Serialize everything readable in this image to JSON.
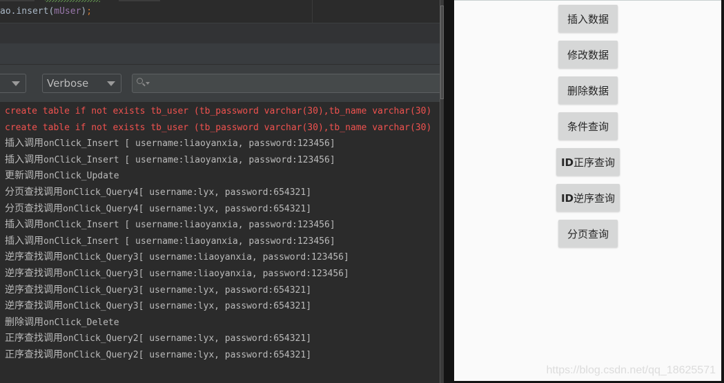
{
  "editor": {
    "code_prefix": "ao.",
    "code_method": "insert(",
    "code_arg": "mUser",
    "code_close": ")",
    "code_semi": ";"
  },
  "logcat": {
    "device_dropdown": {
      "value": ""
    },
    "level_dropdown": {
      "value": "Verbose"
    },
    "search": {
      "value": "",
      "placeholder": ""
    },
    "lines": [
      {
        "level": "error",
        "cjk": "",
        "text": "create table if not exists tb_user (tb_password varchar(30),tb_name varchar(30)"
      },
      {
        "level": "error",
        "cjk": "",
        "text": "create table if not exists tb_user (tb_password varchar(30),tb_name varchar(30)"
      },
      {
        "level": "info",
        "cjk": "插入调用",
        "text": "onClick_Insert [ username:liaoyanxia, password:123456]"
      },
      {
        "level": "info",
        "cjk": "插入调用",
        "text": "onClick_Insert [ username:liaoyanxia, password:123456]"
      },
      {
        "level": "info",
        "cjk": "更新调用",
        "text": "onClick_Update"
      },
      {
        "level": "info",
        "cjk": "分页查找调用",
        "text": "onClick_Query4[ username:lyx, password:654321]"
      },
      {
        "level": "info",
        "cjk": "分页查找调用",
        "text": "onClick_Query4[ username:lyx, password:654321]"
      },
      {
        "level": "info",
        "cjk": "插入调用",
        "text": "onClick_Insert [ username:liaoyanxia, password:123456]"
      },
      {
        "level": "info",
        "cjk": "插入调用",
        "text": "onClick_Insert [ username:liaoyanxia, password:123456]"
      },
      {
        "level": "info",
        "cjk": "逆序查找调用",
        "text": "onClick_Query3[ username:liaoyanxia, password:123456]"
      },
      {
        "level": "info",
        "cjk": "逆序查找调用",
        "text": "onClick_Query3[ username:liaoyanxia, password:123456]"
      },
      {
        "level": "info",
        "cjk": "逆序查找调用",
        "text": "onClick_Query3[ username:lyx, password:654321]"
      },
      {
        "level": "info",
        "cjk": "逆序查找调用",
        "text": "onClick_Query3[ username:lyx, password:654321]"
      },
      {
        "level": "info",
        "cjk": "删除调用",
        "text": "onClick_Delete"
      },
      {
        "level": "info",
        "cjk": "正序查找调用",
        "text": "onClick_Query2[ username:lyx, password:654321]"
      },
      {
        "level": "info",
        "cjk": "正序查找调用",
        "text": "onClick_Query2[ username:lyx, password:654321]"
      }
    ]
  },
  "app": {
    "buttons": [
      {
        "id": "insert",
        "prefix": "",
        "label": "插入数据"
      },
      {
        "id": "update",
        "prefix": "",
        "label": "修改数据"
      },
      {
        "id": "delete",
        "prefix": "",
        "label": "删除数据"
      },
      {
        "id": "query-condition",
        "prefix": "",
        "label": "条件查询"
      },
      {
        "id": "query-id-asc",
        "prefix": "ID",
        "label": "正序查询"
      },
      {
        "id": "query-id-desc",
        "prefix": "ID",
        "label": "逆序查询"
      },
      {
        "id": "query-paged",
        "prefix": "",
        "label": "分页查询"
      }
    ],
    "watermark": "https://blog.csdn.net/qq_18625571"
  },
  "colors": {
    "log_error": "#f0524f",
    "log_info": "#bbbbbb",
    "ide_background": "#2b2b2b",
    "app_background": "#fafafa",
    "button_background": "#d6d7d7"
  }
}
